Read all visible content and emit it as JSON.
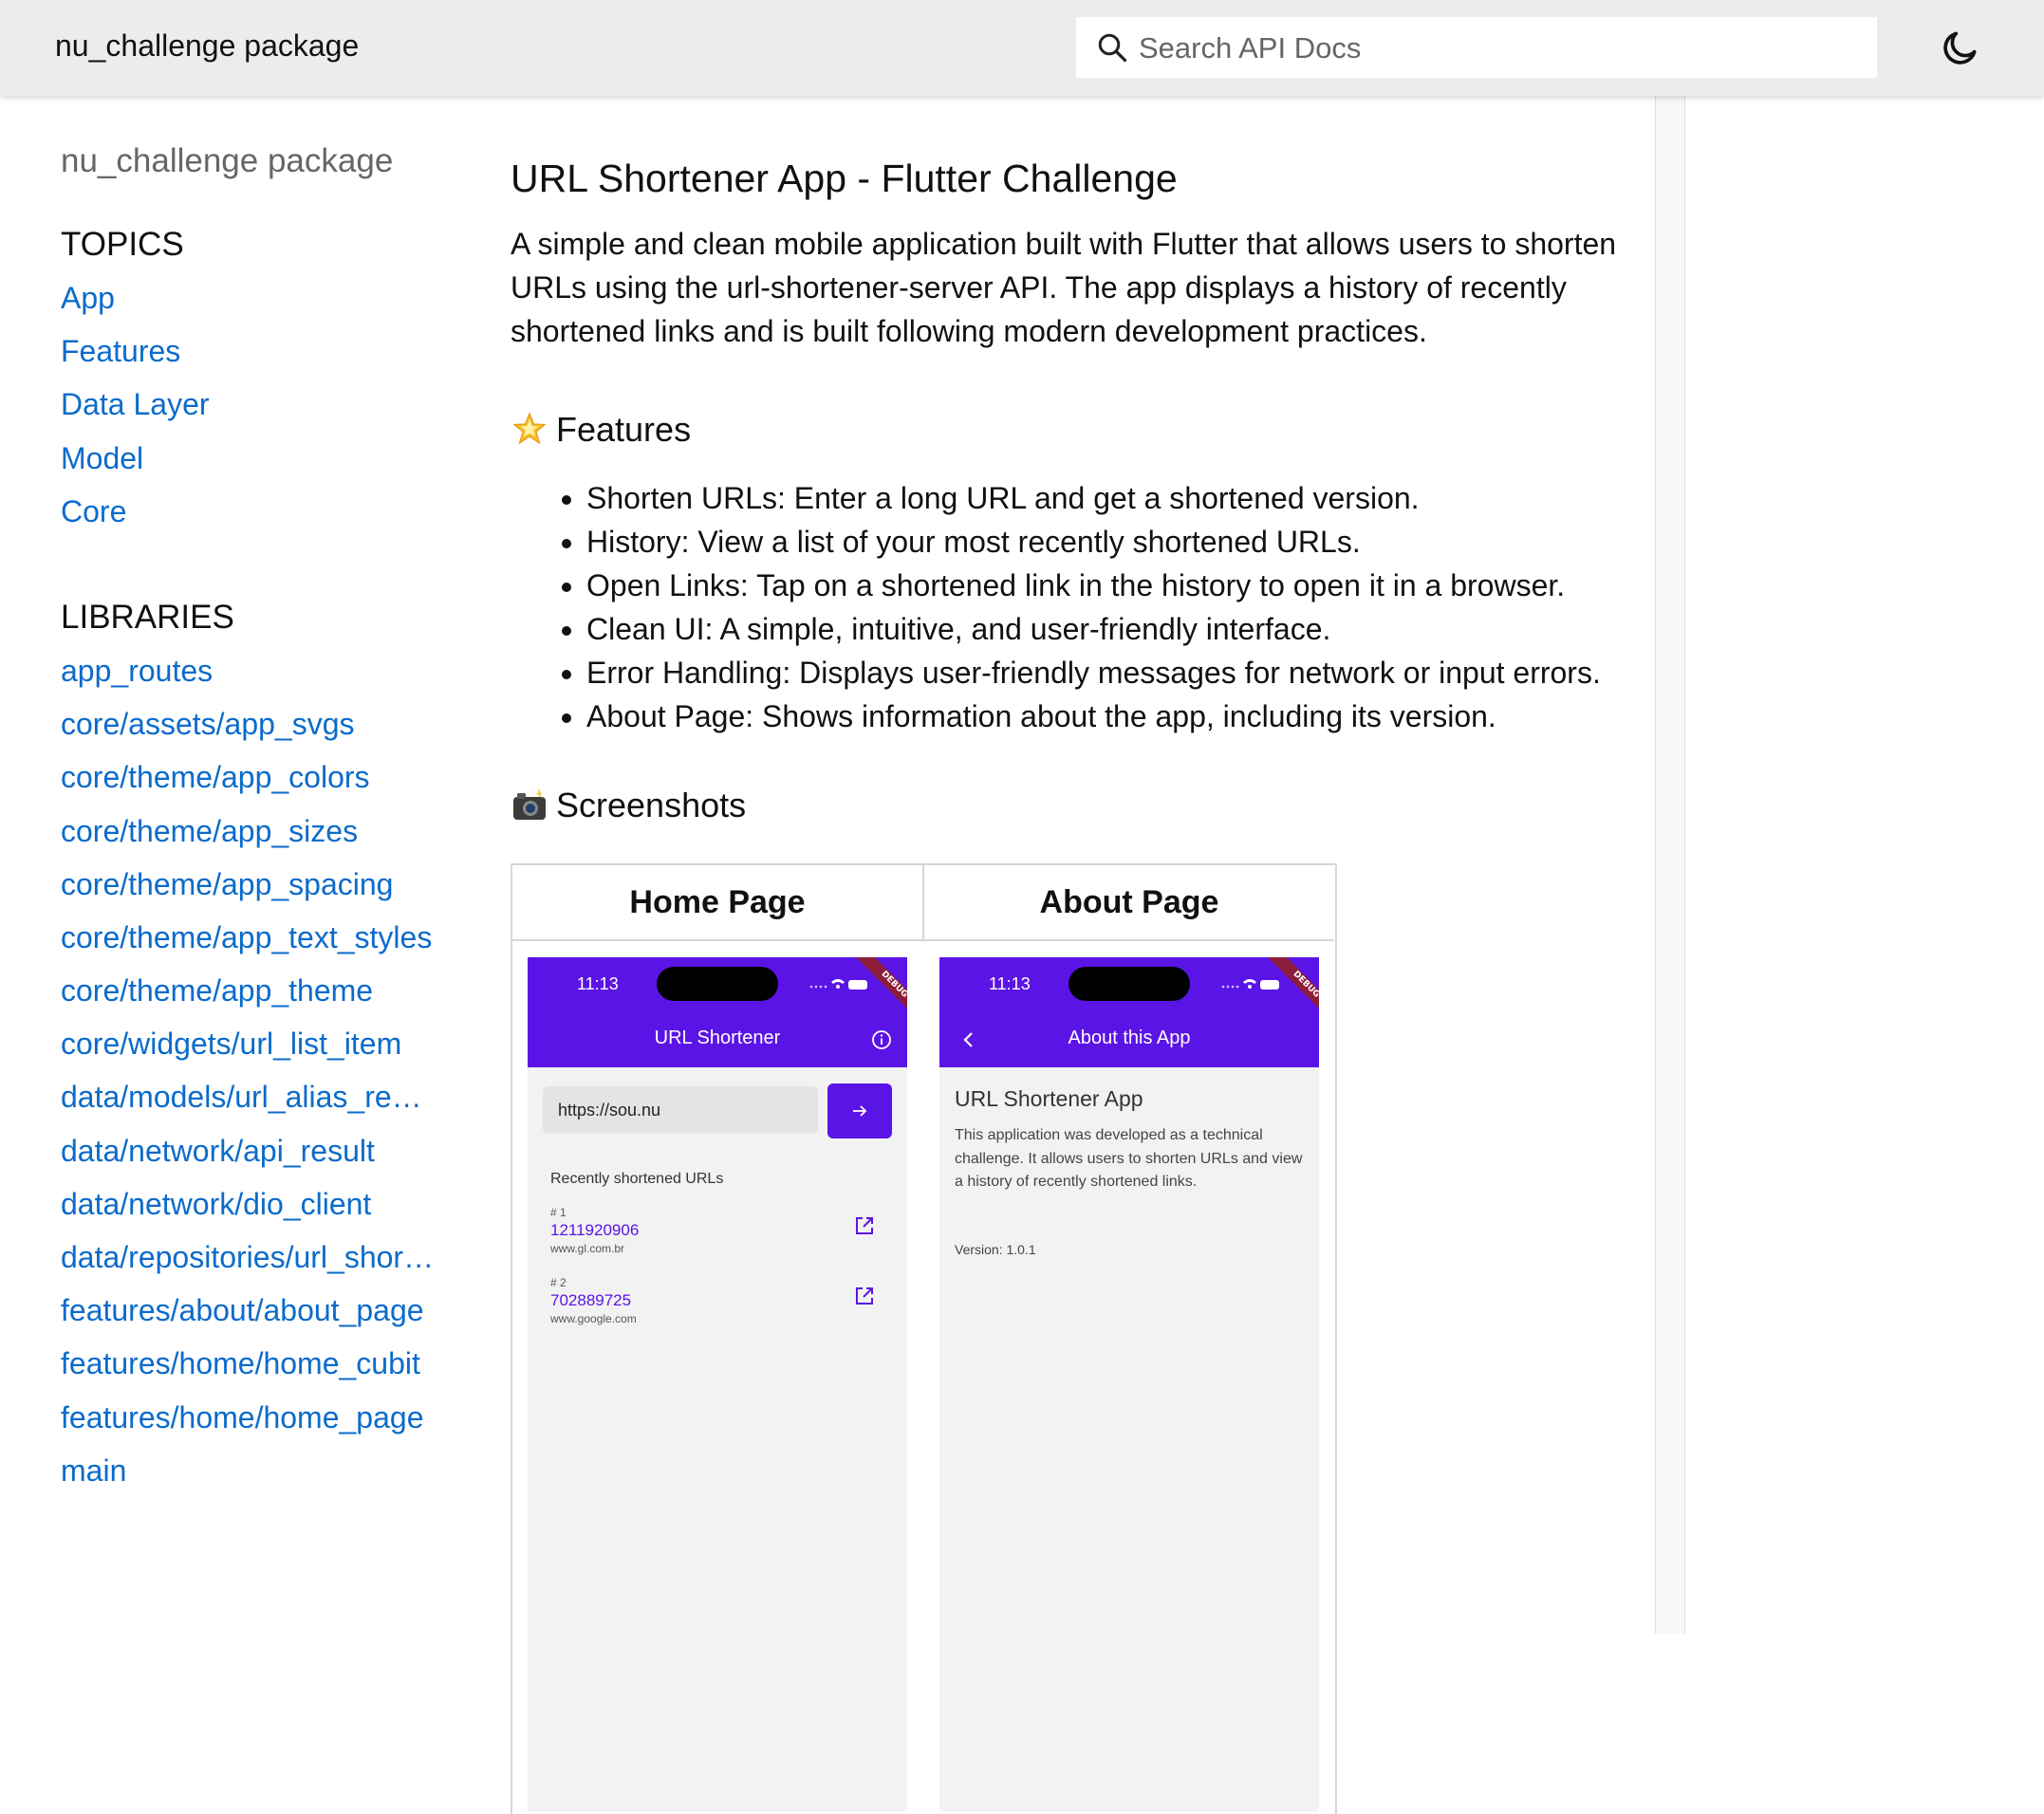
{
  "header": {
    "title": "nu_challenge package",
    "search_placeholder": "Search API Docs"
  },
  "sidebar": {
    "title": "nu_challenge package",
    "topics_heading": "TOPICS",
    "topics": [
      "App",
      "Features",
      "Data Layer",
      "Model",
      "Core"
    ],
    "libraries_heading": "LIBRARIES",
    "libraries": [
      "app_routes",
      "core/assets/app_svgs",
      "core/theme/app_colors",
      "core/theme/app_sizes",
      "core/theme/app_spacing",
      "core/theme/app_text_styles",
      "core/theme/app_theme",
      "core/widgets/url_list_item",
      "data/models/url_alias_re…",
      "data/network/api_result",
      "data/network/dio_client",
      "data/repositories/url_shor…",
      "features/about/about_page",
      "features/home/home_cubit",
      "features/home/home_page",
      "main"
    ]
  },
  "main": {
    "title": "URL Shortener App - Flutter Challenge",
    "intro": "A simple and clean mobile application built with Flutter that allows users to shorten URLs using the url-shortener-server API. The app displays a history of recently shortened links and is built following modern development practices.",
    "features_heading": "Features",
    "features": [
      "Shorten URLs: Enter a long URL and get a shortened version.",
      "History: View a list of your most recently shortened URLs.",
      "Open Links: Tap on a shortened link in the history to open it in a browser.",
      "Clean UI: A simple, intuitive, and user-friendly interface.",
      "Error Handling: Displays user-friendly messages for network or input errors.",
      "About Page: Shows information about the app, including its version."
    ],
    "screenshots_heading": "Screenshots",
    "table_headers": [
      "Home Page",
      "About Page"
    ]
  },
  "home_screen": {
    "time": "11:13",
    "debug": "DEBUG",
    "title": "URL Shortener",
    "input_value": "https://sou.nu",
    "recent_title": "Recently shortened URLs",
    "items": [
      {
        "num": "# 1",
        "alias": "1211920906",
        "orig": "www.gl.com.br"
      },
      {
        "num": "# 2",
        "alias": "702889725",
        "orig": "www.google.com"
      }
    ]
  },
  "about_screen": {
    "time": "11:13",
    "debug": "DEBUG",
    "title": "About this App",
    "heading": "URL Shortener App",
    "body": "This application was developed as a technical challenge. It allows users to shorten URLs and view a history of recently shortened links.",
    "version": "Version: 1.0.1"
  },
  "colors": {
    "accent": "#5b14e6",
    "link": "#0b6bcb",
    "header_bg": "#ececec"
  }
}
